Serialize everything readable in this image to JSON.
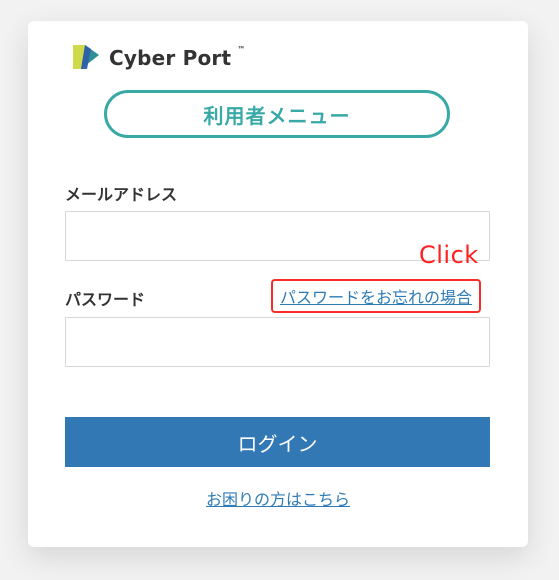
{
  "brand": {
    "name": "Cyber Port",
    "tm": "™"
  },
  "menu": {
    "title": "利用者メニュー"
  },
  "form": {
    "email_label": "メールアドレス",
    "password_label": "パスワード",
    "forgot_password_link": "パスワードをお忘れの場合"
  },
  "actions": {
    "login_label": "ログイン",
    "help_link": "お困りの方はこちら"
  },
  "annotation": {
    "click_label": "Click"
  },
  "colors": {
    "teal": "#38a9a6",
    "primary": "#3178b5",
    "link": "#2f7bb7",
    "highlight_red": "#ff2a2a"
  },
  "icons": {
    "logo": "cyberport-logo-icon"
  }
}
